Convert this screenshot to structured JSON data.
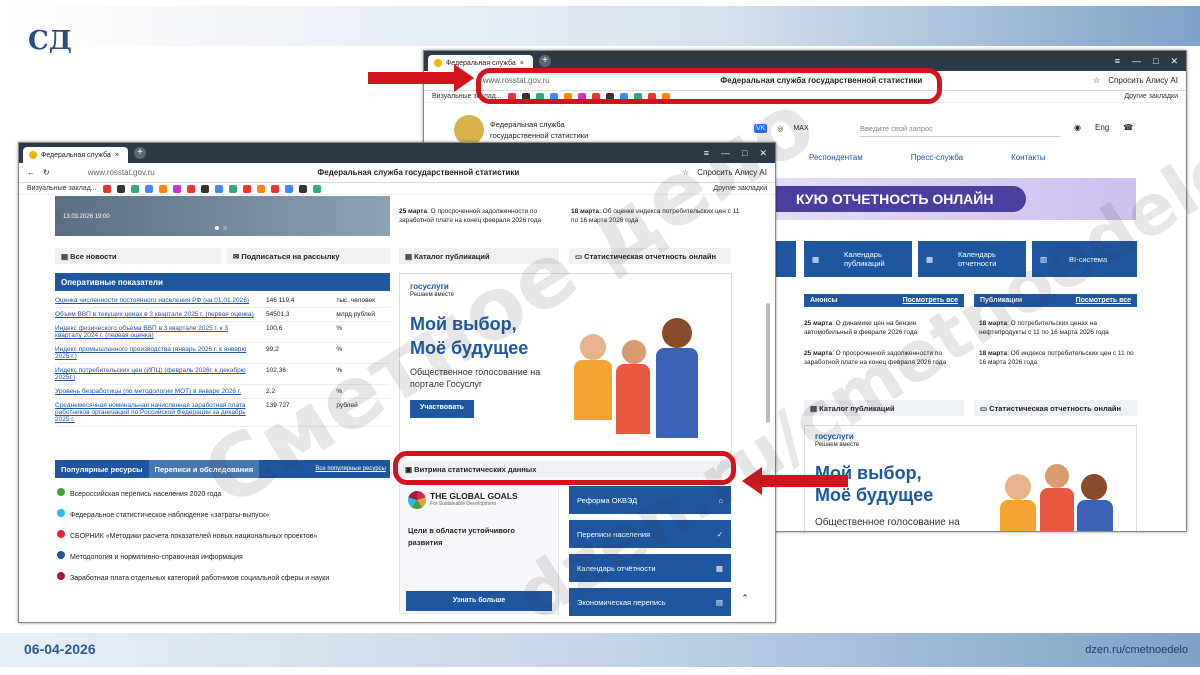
{
  "slide": {
    "logo": "СД",
    "date": "06-04-2026",
    "source": "dzen.ru/cmetnoedelo",
    "watermark": "Сметное дело dzen.ru/cmetnoedelo"
  },
  "back": {
    "tab": "Федеральная служба",
    "url": "www.rosstat.gov.ru",
    "title": "Федеральная служба государственной статистики",
    "alice": "Спросить Алису AI",
    "bookmarks": "Визуальные заклад...",
    "other": "Другие закладки",
    "org1": "Федеральная служба",
    "org2": "государственной статистики",
    "max": "MAX",
    "search": "Введите свой запрос",
    "lang": "Eng",
    "nav": [
      "Респондентам",
      "Пресс-служба",
      "Контакты"
    ],
    "banner": "КУЮ ОТЧЕТНОСТЬ ОНЛАЙН",
    "tiles": [
      "Календарь публикаций",
      "Календарь отчетности",
      "BI-система"
    ],
    "announces": "Анонсы",
    "pubs": "Публикации",
    "seeall": "Посмотреть все",
    "ann1_date": "25 марта",
    "ann1": ": О динамике цен на бензин автомобильный в феврале 2026 года",
    "ann2_date": "25 марта",
    "ann2": ": О просроченной задолженности по заработной плате на конец февраля 2026 года",
    "pub1_date": "18 марта",
    "pub1": ": О потребительских ценах на нефтепродукты с 11 по 16 марта 2026 года",
    "pub2_date": "18 марта",
    "pub2": ": Об индексе потребительских цен с 11 по 16 марта 2026 года",
    "catalog": "Каталог публикаций",
    "statrep": "Статистическая отчетность онлайн",
    "gos": "госуслуги",
    "gos_sub": "Решаем вместе",
    "promo1": "Мой выбор,",
    "promo2": "Моё будущее",
    "promo3": "Общественное голосование на"
  },
  "front": {
    "tab": "Федеральная служба",
    "url": "www.rosstat.gov.ru",
    "title": "Федеральная служба государственной статистики",
    "alice": "Спросить Алису AI",
    "bookmarks": "Визуальные заклад...",
    "other": "Другие закладки",
    "photo_date": "13.03.2026 19:00",
    "news25": "25 марта",
    "news25t": ": О просроченной задолженности по заработной плате на конец февраля 2026 года",
    "news18": "18 марта",
    "news18t": ": Об оценке индекса потребительских цен с 11 по 16 марта 2026 года",
    "allnews": "Все новости",
    "subscribe": "Подписаться на рассылку",
    "catalog": "Каталог публикаций",
    "statrep": "Статистическая отчетность онлайн",
    "oper": "Оперативные показатели",
    "indicators": [
      {
        "n": "Оценка численности постоянного населения РФ (на 01.01.2026)",
        "v": "146 119,4",
        "u": "тыс. человек"
      },
      {
        "n": "Объем ВВП в текущих ценах в 3 квартале 2025 г. (первая оценка)",
        "v": "54501,3",
        "u": "млрд рублей"
      },
      {
        "n": "Индекс физического объема ВВП в 3 квартале 2025 г. к 3 кварталу 2024 г. (первая оценка)",
        "v": "100,6",
        "u": "%"
      },
      {
        "n": "Индекс промышленного производства (январь 2026 г. к январю 2025 г.)",
        "v": "99,2",
        "u": "%"
      },
      {
        "n": "Индекс потребительских цен (ИПЦ) (февраль 2026г. к декабрю 2025г.)",
        "v": "102,36",
        "u": "%"
      },
      {
        "n": "Уровень безработицы (по методологии МОТ) в январе 2026 г.",
        "v": "2,2",
        "u": "%"
      },
      {
        "n": "Среднемесячная номинальная начисленная заработная плата работников организаций по Российской Федерации за декабрь 2025 г.",
        "v": "139 727",
        "u": "рублей"
      }
    ],
    "tabs": [
      "Популярные ресурсы",
      "Переписи и обследования"
    ],
    "allpopular": "Все популярные ресурсы",
    "resources": [
      "Всероссийская перепись населения 2020 года",
      "Федеральное статистическое наблюдение «затраты-выпуск»",
      "СБОРНИК «Методики расчета показателей новых национальных проектов»",
      "Методология и нормативно-справочная информация",
      "Заработная плата отдельных категорий работников социальной сферы и науки"
    ],
    "gos": "госуслуги",
    "gos_sub": "Решаем вместе",
    "promo1": "Мой выбор,",
    "promo2": "Моё будущее",
    "promo3": "Общественное голосование на портале Госуслуг",
    "vote": "Участвовать",
    "vitrina": "Витрина статистических данных",
    "goals": "THE GLOBAL GOALS",
    "goals_sub": "For Sustainable Development",
    "goals_text": "Цели в области устойчивого развития",
    "more": "Узнать больше",
    "side": [
      "Реформа ОКВЭД",
      "Переписи населения",
      "Календарь отчётности",
      "Экономическая перепись"
    ]
  }
}
